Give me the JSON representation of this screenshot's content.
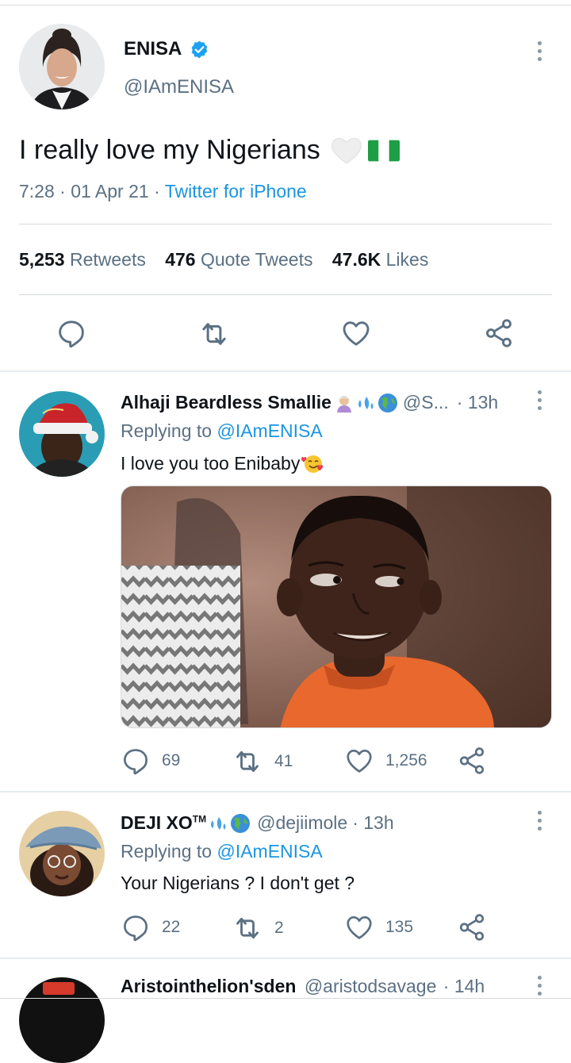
{
  "main_tweet": {
    "author_name": "ENISA",
    "handle": "@IAmENISA",
    "text": "I really love my Nigerians",
    "time": "7:28",
    "date": "01 Apr 21",
    "source": "Twitter for iPhone",
    "date_sep": "·",
    "source_sep": "·",
    "retweets_count": "5,253",
    "retweets_label": "Retweets",
    "quotes_count": "476",
    "quotes_label": "Quote Tweets",
    "likes_count": "47.6K",
    "likes_label": "Likes"
  },
  "replies": [
    {
      "name": "Alhaji Beardless Smallie",
      "handle": "@S...",
      "time": "· 13h",
      "replying_prefix": "Replying to",
      "replying_handle": "@IAmENISA",
      "text": "I love you too Enibaby",
      "reply_count": "69",
      "retweet_count": "41",
      "like_count": "1,256"
    },
    {
      "name": "DEJI XO",
      "name_sup": "TM",
      "handle": "@dejiimole",
      "time": "· 13h",
      "replying_prefix": "Replying to",
      "replying_handle": "@IAmENISA",
      "text": "Your Nigerians ? I don't get ?",
      "reply_count": "22",
      "retweet_count": "2",
      "like_count": "135"
    },
    {
      "name": "Aristointhelion'sden",
      "handle": "@aristodsavage",
      "time": "· 14h"
    }
  ],
  "colors": {
    "accent": "#1b95e0",
    "muted": "#5b7083",
    "divider": "#d6d9db"
  },
  "icons": [
    "verified-badge-icon",
    "reply-icon",
    "retweet-icon",
    "like-icon",
    "share-icon",
    "more-dots-icon"
  ]
}
